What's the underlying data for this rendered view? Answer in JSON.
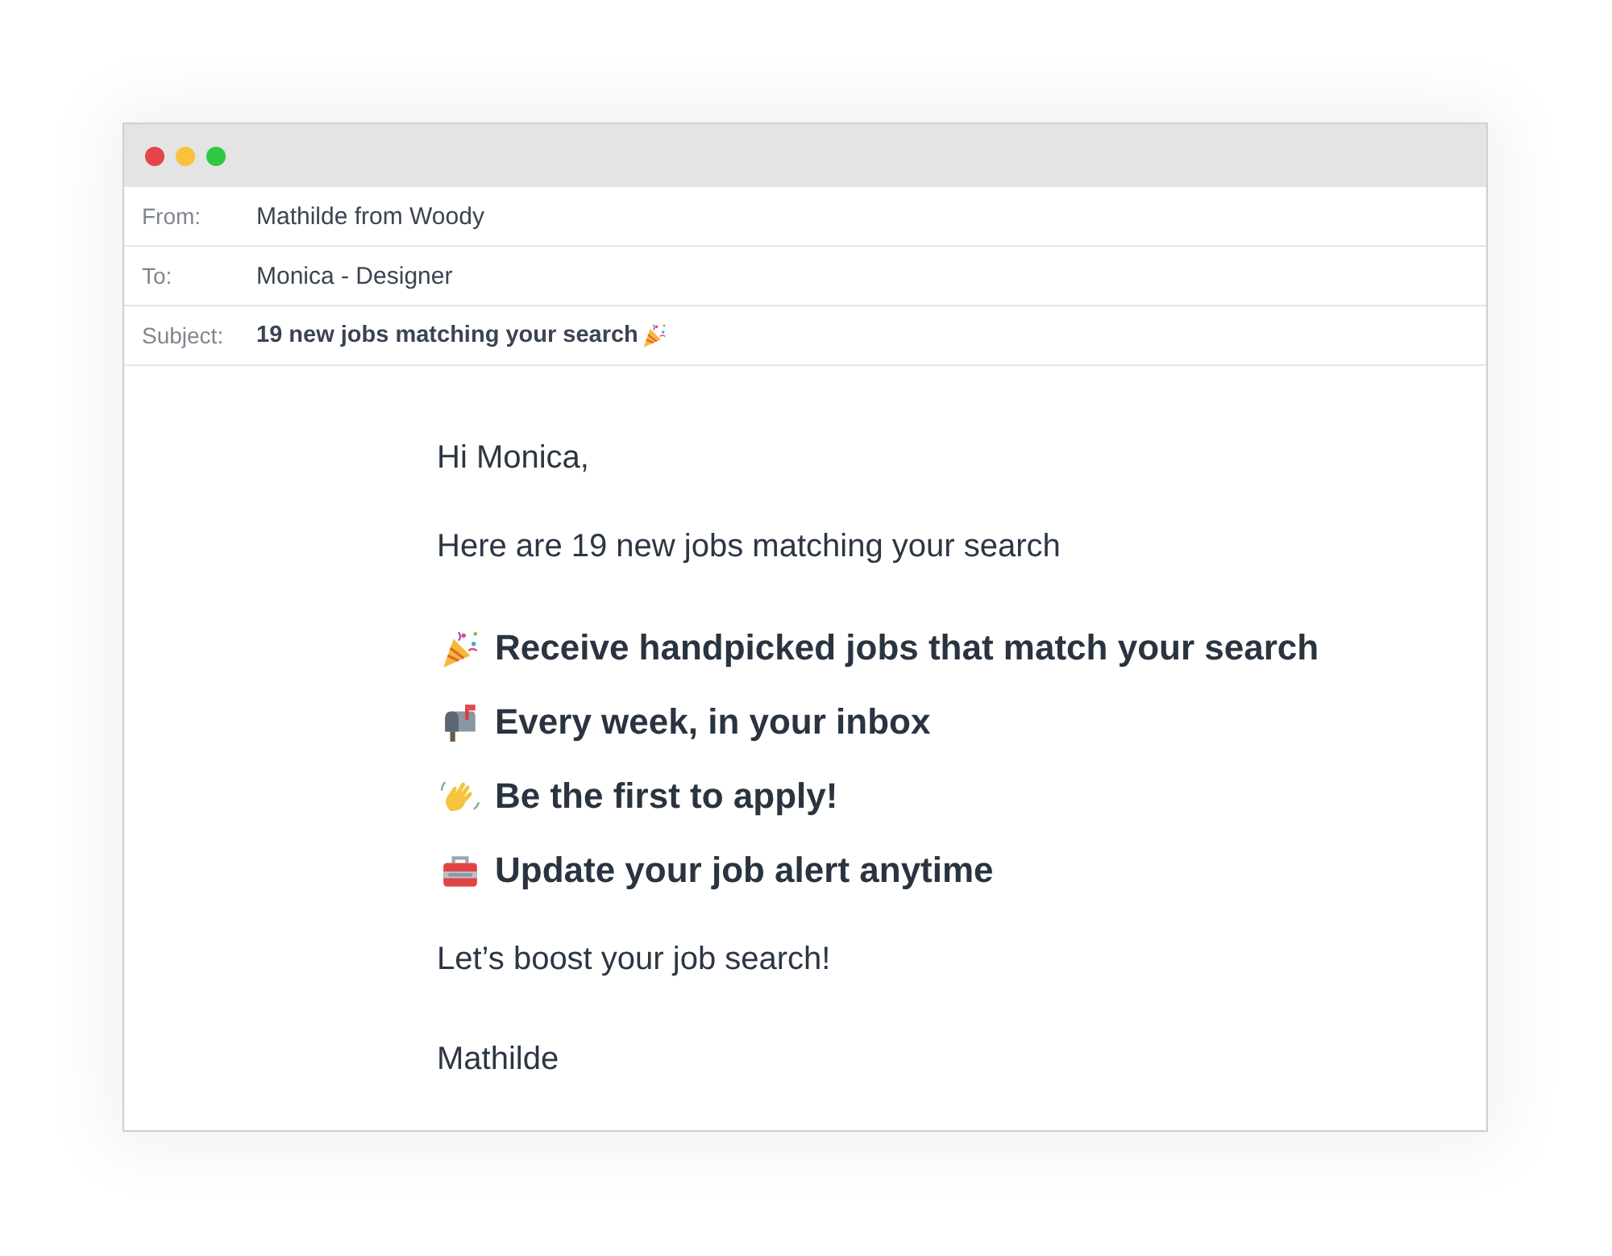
{
  "header": [
    {
      "kind": "plain",
      "label": "From:",
      "value": "Mathilde from Woody"
    },
    {
      "kind": "plain",
      "label": "To:",
      "value": "Monica - Designer"
    },
    {
      "kind": "subject",
      "label": "Subject:",
      "value": "19 new jobs matching your search"
    }
  ],
  "body": {
    "greeting": "Hi Monica,",
    "intro": "Here are 19 new jobs matching your search",
    "highlights": [
      {
        "kind": "party",
        "text": "Receive handpicked jobs that match your search"
      },
      {
        "kind": "mailbox",
        "text": "Every week, in your inbox"
      },
      {
        "kind": "wave",
        "text": "Be the first to apply!"
      },
      {
        "kind": "toolbox",
        "text": "Update your job alert anytime"
      }
    ],
    "closing": "Let’s boost your job search!",
    "signature": "Mathilde"
  }
}
